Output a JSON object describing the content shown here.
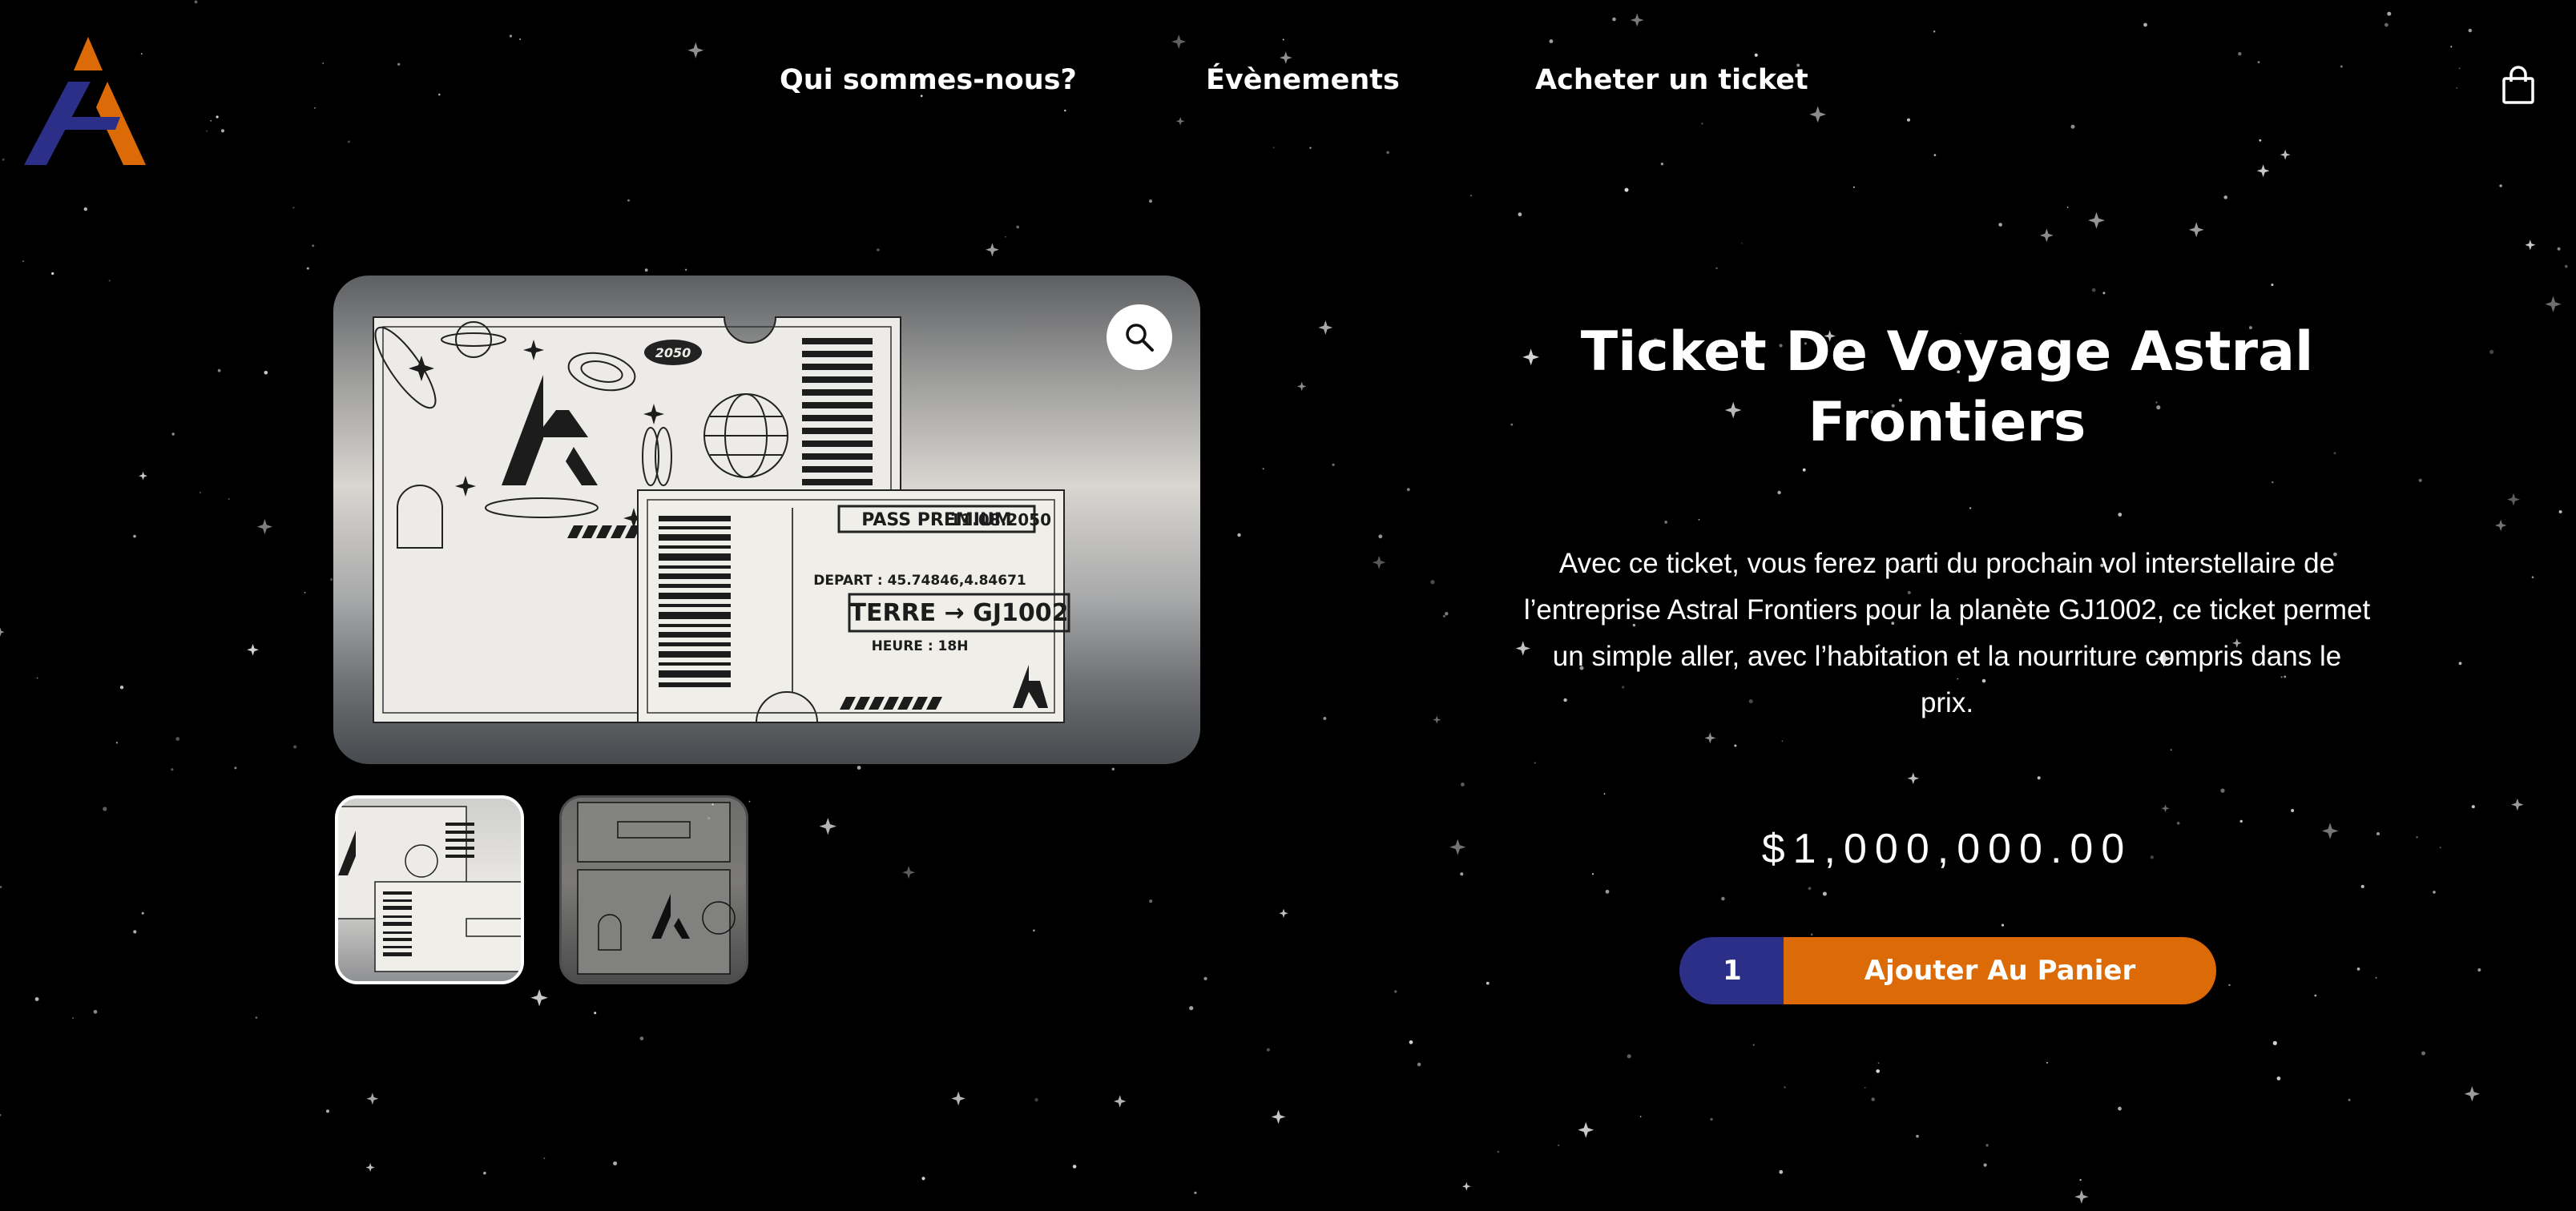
{
  "brand": {
    "logo_icon": "astral-frontiers-logo",
    "colors": {
      "orange": "#db6a07",
      "indigo": "#2c2f87",
      "background": "#000000"
    }
  },
  "nav": {
    "items": [
      {
        "label": "Qui sommes-nous?"
      },
      {
        "label": "Évènements"
      },
      {
        "label": "Acheter un ticket"
      }
    ],
    "cart_icon": "shopping-bag-icon"
  },
  "gallery": {
    "zoom_icon": "magnifier-icon",
    "ticket": {
      "year": "2050",
      "pass": "PASS PREMIUM",
      "date": "11.08.2050",
      "depart": "DEPART : 45.74846,4.84671",
      "route": "TERRE → GJ1002",
      "heure": "HEURE : 18H"
    }
  },
  "product": {
    "title": "Ticket De Voyage Astral Frontiers",
    "description": "Avec ce ticket, vous ferez parti du prochain vol interstellaire de l’entreprise Astral Frontiers pour la planète GJ1002, ce ticket permet un simple aller, avec l’habitation et la nourriture compris dans le prix.",
    "price": "$1,000,000.00",
    "quantity": "1",
    "add_to_cart_label": "Ajouter Au Panier"
  }
}
